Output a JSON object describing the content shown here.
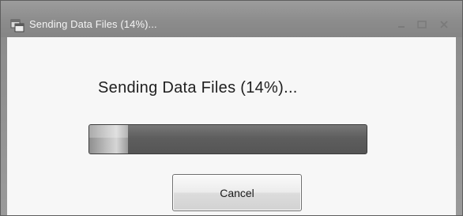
{
  "window": {
    "title": "Sending Data Files (14%)...",
    "icon": "app-window-icon",
    "controls": [
      "minimize-icon",
      "maximize-icon",
      "close-icon"
    ]
  },
  "dialog": {
    "message": "Sending Data Files (14%)...",
    "progress_fraction": 0.14,
    "cancel_label": "Cancel"
  },
  "colors": {
    "titlebar": "#8c8c8c",
    "progress_track": "#5e5e5e",
    "progress_fill": "#c8c8c8"
  }
}
